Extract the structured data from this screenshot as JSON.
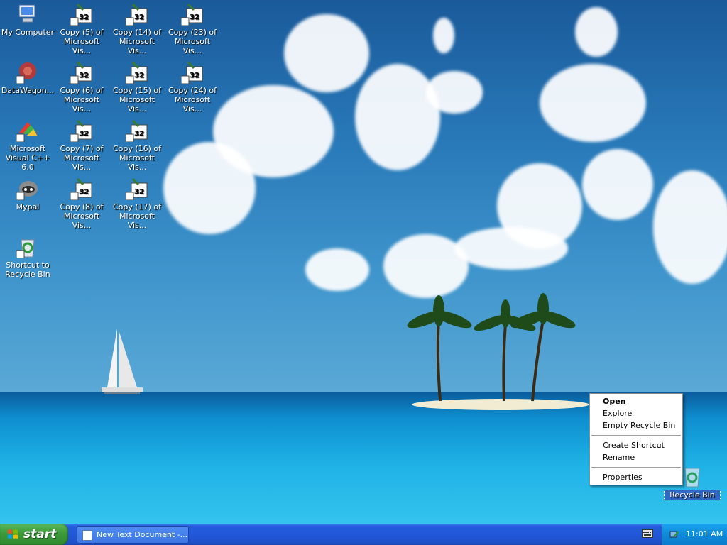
{
  "desktop": {
    "icons": [
      {
        "label": "My Computer",
        "icon": "my-computer-icon"
      },
      {
        "label": "DataWagon...",
        "icon": "datawagon-icon"
      },
      {
        "label": "Microsoft Visual C++ 6.0",
        "icon": "visual-cpp-icon"
      },
      {
        "label": "Mypal",
        "icon": "mypal-icon"
      },
      {
        "label": "Shortcut to Recycle Bin",
        "icon": "recycle-bin-shortcut-icon"
      },
      {
        "label": "Copy (5) of Microsoft Vis...",
        "icon": "win32-shortcut-icon"
      },
      {
        "label": "Copy (6) of Microsoft Vis...",
        "icon": "win32-shortcut-icon"
      },
      {
        "label": "Copy (7) of Microsoft Vis...",
        "icon": "win32-shortcut-icon"
      },
      {
        "label": "Copy (8) of Microsoft Vis...",
        "icon": "win32-shortcut-icon"
      },
      {
        "label": "Copy (14) of Microsoft Vis...",
        "icon": "win32-shortcut-icon"
      },
      {
        "label": "Copy (15) of Microsoft Vis...",
        "icon": "win32-shortcut-icon"
      },
      {
        "label": "Copy (16) of Microsoft Vis...",
        "icon": "win32-shortcut-icon"
      },
      {
        "label": "Copy (17) of Microsoft Vis...",
        "icon": "win32-shortcut-icon"
      },
      {
        "label": "Copy (23) of Microsoft Vis...",
        "icon": "win32-shortcut-icon"
      },
      {
        "label": "Copy (24) of Microsoft Vis...",
        "icon": "win32-shortcut-icon"
      },
      {
        "label": "Recycle Bin",
        "icon": "recycle-bin-icon"
      }
    ]
  },
  "context_menu": {
    "open": "Open",
    "explore": "Explore",
    "empty": "Empty Recycle Bin",
    "create_shortcut": "Create Shortcut",
    "rename": "Rename",
    "properties": "Properties"
  },
  "taskbar": {
    "start_label": "start",
    "task_label": "New Text Document -...",
    "clock": "11:01 AM"
  }
}
